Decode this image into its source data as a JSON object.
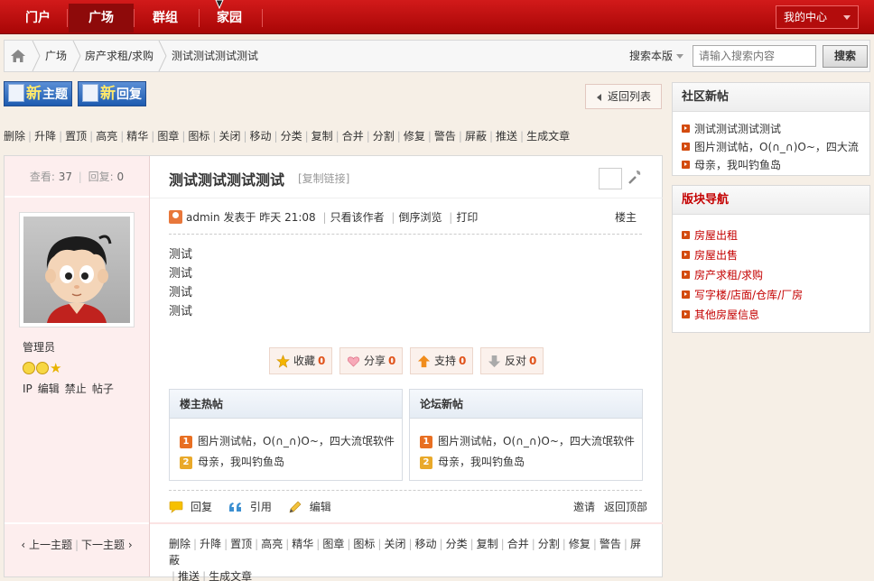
{
  "topnav": {
    "items": [
      {
        "label": "门户"
      },
      {
        "label": "广场"
      },
      {
        "label": "群组"
      },
      {
        "label": "家园"
      }
    ],
    "active": "广场",
    "my_center": "我的中心"
  },
  "breadcrumb": {
    "items": [
      "广场",
      "房产求租/求购",
      "测试测试测试测试"
    ]
  },
  "search": {
    "scope": "搜索本版",
    "placeholder": "请输入搜索内容",
    "button": "搜索"
  },
  "actions": {
    "new_thread_big": "新",
    "new_thread_rest": "主题",
    "new_reply_big": "新",
    "new_reply_rest": "回复",
    "back_to_list": "返回列表"
  },
  "mod_actions": [
    "删除",
    "升降",
    "置顶",
    "高亮",
    "精华",
    "图章",
    "图标",
    "关闭",
    "移动",
    "分类",
    "复制",
    "合并",
    "分割",
    "修复",
    "警告",
    "屏蔽",
    "推送",
    "生成文章"
  ],
  "stats": {
    "views_label": "查看:",
    "views": "37",
    "replies_label": "回复:",
    "replies": "0"
  },
  "user": {
    "role": "管理员",
    "links": [
      "IP",
      "编辑",
      "禁止",
      "帖子"
    ]
  },
  "thread_nav": {
    "prev": "‹ 上一主题",
    "next": "下一主题 ›"
  },
  "post": {
    "title": "测试测试测试测试",
    "copy_link": "[复制链接]",
    "author": "admin",
    "posted_label": "发表于",
    "posted_time": "昨天 21:08",
    "only_author": "只看该作者",
    "reverse": "倒序浏览",
    "print": "打印",
    "floor": "楼主",
    "content": [
      "测试",
      "测试",
      "测试",
      "测试"
    ]
  },
  "buttons": {
    "favorite": {
      "label": "收藏",
      "count": "0"
    },
    "share": {
      "label": "分享",
      "count": "0"
    },
    "support": {
      "label": "支持",
      "count": "0"
    },
    "oppose": {
      "label": "反对",
      "count": "0"
    }
  },
  "hot_box": {
    "title": "楼主热帖",
    "items": [
      {
        "rank": "1",
        "text": "图片测试帖，O(∩_∩)O~，四大流氓软件"
      },
      {
        "rank": "2",
        "text": "母亲，我叫钓鱼岛"
      }
    ]
  },
  "new_box": {
    "title": "论坛新帖",
    "items": [
      {
        "rank": "1",
        "text": "图片测试帖，O(∩_∩)O~，四大流氓软件"
      },
      {
        "rank": "2",
        "text": "母亲，我叫钓鱼岛"
      }
    ]
  },
  "reply_actions": {
    "reply": "回复",
    "quote": "引用",
    "edit": "编辑",
    "invite": "邀请",
    "back_top": "返回顶部"
  },
  "sidebar": {
    "new_posts": {
      "title": "社区新帖",
      "items": [
        "测试测试测试测试",
        "图片测试帖，O(∩_∩)O~，四大流",
        "母亲，我叫钓鱼岛"
      ]
    },
    "forum_nav": {
      "title": "版块导航",
      "items": [
        "房屋出租",
        "房屋出售",
        "房产求租/求购",
        "写字楼/店面/仓库/厂房",
        "其他房屋信息"
      ]
    }
  },
  "colors": {
    "nav_red": "#c40000",
    "accent_orange": "#e0531b",
    "new_btn_blue": "#1d5bb0"
  }
}
